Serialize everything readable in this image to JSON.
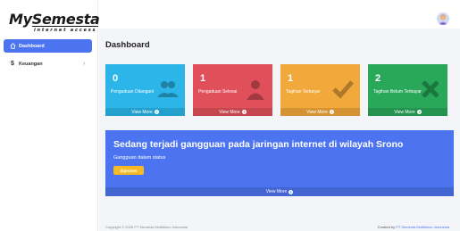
{
  "brand": {
    "logo_prefix": "My",
    "logo_main": "Semesta",
    "logo_tagline": "internet access"
  },
  "sidebar": {
    "items": [
      {
        "label": "Dashboard",
        "icon": "home-icon",
        "active": true
      },
      {
        "label": "Keuangan",
        "icon": "dollar-icon",
        "active": false,
        "has_submenu": true
      }
    ]
  },
  "header": {
    "title": "Dashboard"
  },
  "cards": [
    {
      "count": "0",
      "label": "Pengaduan Ditangani",
      "more": "View More",
      "icon": "users-icon",
      "color": "#2bb5e8"
    },
    {
      "count": "1",
      "label": "Pengaduan Selesai",
      "more": "View More",
      "icon": "user-icon",
      "color": "#e0505a"
    },
    {
      "count": "1",
      "label": "Tagihan Terbayar",
      "more": "View More",
      "icon": "check-icon",
      "color": "#f2a93b"
    },
    {
      "count": "2",
      "label": "Tagihan Belum Terbayar",
      "more": "View More",
      "icon": "x-icon",
      "color": "#29a85a"
    }
  ],
  "banner": {
    "title": "Sedang terjadi gangguan pada jaringan internet di wilayah Srono",
    "subtitle": "Gangguan dalam status",
    "status_badge": "diproses",
    "more": "View More",
    "color": "#4c74f0"
  },
  "footer": {
    "copyright": "Copyright © 2026 PT Semesta Multiteknо Indonesia",
    "created_by_prefix": "Created by ",
    "created_by_link": "PT Semesta Multiteknо Indonesia"
  },
  "colors": {
    "accent": "#4c74f0",
    "badge": "#f7b924"
  }
}
